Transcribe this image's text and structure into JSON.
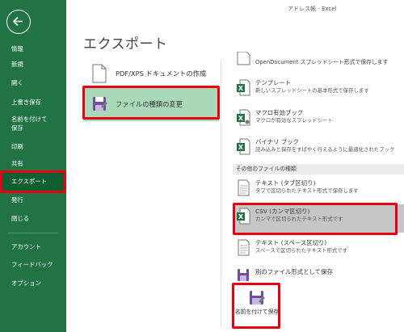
{
  "window": {
    "title": "アドレス帳 - Excel"
  },
  "sidebar": {
    "items": [
      {
        "label": "情報"
      },
      {
        "label": "新規"
      },
      {
        "label": "開く"
      },
      {
        "label": "上書き保存"
      },
      {
        "label": "名前を付けて保存"
      },
      {
        "label": "印刷"
      },
      {
        "label": "共有"
      },
      {
        "label": "エクスポート"
      },
      {
        "label": "発行"
      },
      {
        "label": "閉じる"
      },
      {
        "label": "アカウント"
      },
      {
        "label": "フィードバック"
      },
      {
        "label": "オプション"
      }
    ]
  },
  "page": {
    "title": "エクスポート"
  },
  "export_options": [
    {
      "label": "PDF/XPS ドキュメントの作成",
      "icon": "pdf-document-icon"
    },
    {
      "label": "ファイルの種類の変更",
      "icon": "change-file-type-icon"
    }
  ],
  "file_types": [
    {
      "name": "OpenDocument スプレッドシート形式で保存します",
      "desc": "",
      "icon": "opendocument-icon"
    },
    {
      "name": "テンプレート",
      "desc": "新しいスプレッドシートの基本形式で保存します",
      "icon": "excel-template-icon"
    },
    {
      "name": "マクロ有効ブック",
      "desc": "マクロが有効なスプレッドシート",
      "icon": "excel-macro-icon"
    },
    {
      "name": "バイナリ ブック",
      "desc": "読み込みと保存をすばやく行えるように最適化されたブック",
      "icon": "excel-binary-icon"
    }
  ],
  "other_section": {
    "title": "その他のファイルの種類"
  },
  "other_file_types": [
    {
      "name": "テキスト (タブ区切り)",
      "desc": "タブで区切られたテキスト形式で保存します",
      "icon": "text-file-icon"
    },
    {
      "name": "CSV (カンマ区切り)",
      "desc": "カンマで区切られたテキスト形式です",
      "icon": "excel-csv-icon"
    },
    {
      "name": "テキスト (スペース区切り)",
      "desc": "スペースで区切られたテキスト形式です",
      "icon": "text-file-icon"
    },
    {
      "name": "別のファイル形式として保存",
      "desc": "",
      "icon": "other-format-icon"
    }
  ],
  "save_as_button": {
    "label": "名前を付けて保存"
  },
  "colors": {
    "sidebar": "#217346",
    "sidebar_active": "#0f5f30",
    "selected_option": "#a9d9b8",
    "selected_filetype": "#c6c6c6",
    "highlight": "#e60012"
  }
}
